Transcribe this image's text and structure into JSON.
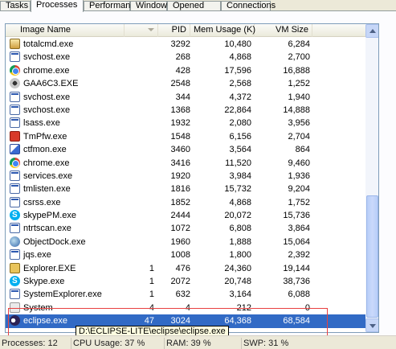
{
  "tabs": [
    {
      "label": "Tasks",
      "active": false
    },
    {
      "label": "Processes",
      "active": true
    },
    {
      "label": "Performance",
      "active": false
    },
    {
      "label": "Windows",
      "active": false
    },
    {
      "label": "Opened Files",
      "active": false
    },
    {
      "label": "Connections",
      "active": false
    }
  ],
  "columns": {
    "image_name": "Image Name",
    "col2": "",
    "pid": "PID",
    "mem": "Mem Usage (K)",
    "vm": "VM Size"
  },
  "processes": [
    {
      "name": "totalcmd.exe",
      "col2": "",
      "pid": "3292",
      "mem": "10,480",
      "vm": "6,284",
      "icon": "total-commander-icon"
    },
    {
      "name": "svchost.exe",
      "col2": "",
      "pid": "268",
      "mem": "4,868",
      "vm": "2,700",
      "icon": "application-icon"
    },
    {
      "name": "chrome.exe",
      "col2": "",
      "pid": "428",
      "mem": "17,596",
      "vm": "16,888",
      "icon": "chrome-icon"
    },
    {
      "name": "GAA6C3.EXE",
      "col2": "",
      "pid": "2548",
      "mem": "2,568",
      "vm": "1,252",
      "icon": "gear-icon"
    },
    {
      "name": "svchost.exe",
      "col2": "",
      "pid": "344",
      "mem": "4,372",
      "vm": "1,940",
      "icon": "application-icon"
    },
    {
      "name": "svchost.exe",
      "col2": "",
      "pid": "1368",
      "mem": "22,864",
      "vm": "14,888",
      "icon": "application-icon"
    },
    {
      "name": "lsass.exe",
      "col2": "",
      "pid": "1932",
      "mem": "2,080",
      "vm": "3,956",
      "icon": "application-icon"
    },
    {
      "name": "TmPfw.exe",
      "col2": "",
      "pid": "1548",
      "mem": "6,156",
      "vm": "2,704",
      "icon": "trend-micro-icon"
    },
    {
      "name": "ctfmon.exe",
      "col2": "",
      "pid": "3460",
      "mem": "3,564",
      "vm": "864",
      "icon": "ctfmon-icon"
    },
    {
      "name": "chrome.exe",
      "col2": "",
      "pid": "3416",
      "mem": "11,520",
      "vm": "9,460",
      "icon": "chrome-icon"
    },
    {
      "name": "services.exe",
      "col2": "",
      "pid": "1920",
      "mem": "3,984",
      "vm": "1,936",
      "icon": "application-icon"
    },
    {
      "name": "tmlisten.exe",
      "col2": "",
      "pid": "1816",
      "mem": "15,732",
      "vm": "9,204",
      "icon": "application-icon"
    },
    {
      "name": "csrss.exe",
      "col2": "",
      "pid": "1852",
      "mem": "4,868",
      "vm": "1,752",
      "icon": "application-icon"
    },
    {
      "name": "skypePM.exe",
      "col2": "",
      "pid": "2444",
      "mem": "20,072",
      "vm": "15,736",
      "icon": "skype-icon"
    },
    {
      "name": "ntrtscan.exe",
      "col2": "",
      "pid": "1072",
      "mem": "6,808",
      "vm": "3,864",
      "icon": "application-icon"
    },
    {
      "name": "ObjectDock.exe",
      "col2": "",
      "pid": "1960",
      "mem": "1,888",
      "vm": "15,064",
      "icon": "objectdock-icon"
    },
    {
      "name": "jqs.exe",
      "col2": "",
      "pid": "1008",
      "mem": "1,800",
      "vm": "2,392",
      "icon": "application-icon"
    },
    {
      "name": "Explorer.EXE",
      "col2": "1",
      "pid": "476",
      "mem": "24,360",
      "vm": "19,144",
      "icon": "explorer-icon"
    },
    {
      "name": "Skype.exe",
      "col2": "1",
      "pid": "2072",
      "mem": "20,748",
      "vm": "38,736",
      "icon": "skype-icon"
    },
    {
      "name": "SystemExplorer.exe",
      "col2": "1",
      "pid": "632",
      "mem": "3,164",
      "vm": "6,088",
      "icon": "system-explorer-icon"
    },
    {
      "name": "System",
      "col2": "4",
      "pid": "4",
      "mem": "212",
      "vm": "0",
      "icon": "system-icon"
    },
    {
      "name": "eclipse.exe",
      "col2": "47",
      "pid": "3024",
      "mem": "64,368",
      "vm": "68,584",
      "icon": "eclipse-icon",
      "selected": true
    }
  ],
  "tooltip": "D:\\ECLIPSE-LITE\\eclipse\\eclipse.exe",
  "status": {
    "processes": "Processes: 12",
    "cpu": "CPU Usage: 37 %",
    "ram": "RAM: 39 %",
    "swp": "SWP: 31 %"
  }
}
